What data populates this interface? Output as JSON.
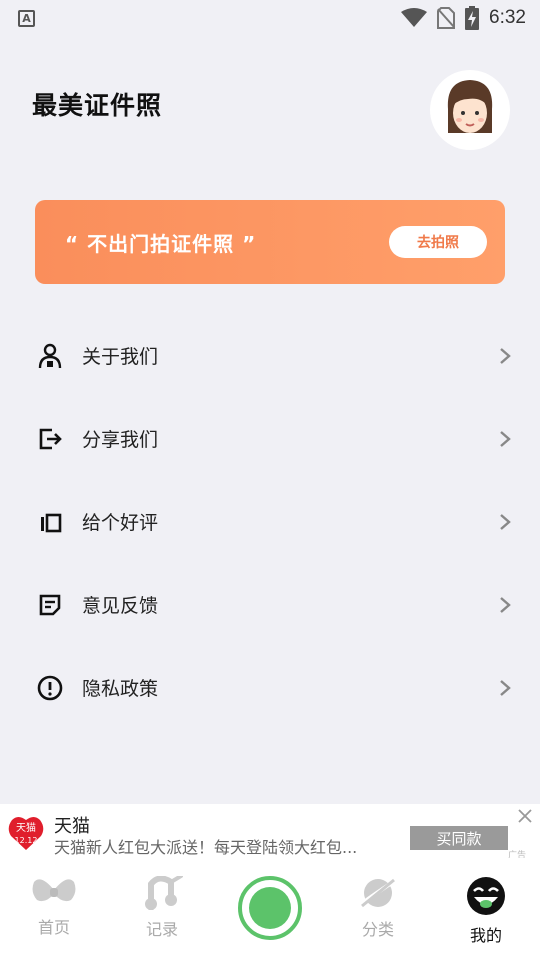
{
  "status_bar": {
    "time": "6:32",
    "a_label": "A"
  },
  "header": {
    "title": "最美证件照"
  },
  "banner": {
    "text": "“ 不出门拍证件照 ”",
    "button_label": "去拍照",
    "colors": {
      "start": "#fa8e5b",
      "end": "#ff9f6a"
    }
  },
  "menu": {
    "items": [
      {
        "label": "关于我们",
        "icon": "user-info-icon"
      },
      {
        "label": "分享我们",
        "icon": "share-icon"
      },
      {
        "label": "给个好评",
        "icon": "rate-icon"
      },
      {
        "label": "意见反馈",
        "icon": "feedback-icon"
      },
      {
        "label": "隐私政策",
        "icon": "privacy-icon"
      }
    ]
  },
  "ad": {
    "brand_logo_text": "天猫",
    "logo_date": "12.12",
    "title": "天猫",
    "description": "天猫新人红包大派送！每天登陆领大红包...",
    "button_label": "买同款",
    "tag": "广告"
  },
  "tabbar": {
    "tabs": [
      {
        "label": "首页",
        "icon": "bow-icon"
      },
      {
        "label": "记录",
        "icon": "record-icon"
      },
      {
        "label": "",
        "icon": "camera-shutter-icon"
      },
      {
        "label": "分类",
        "icon": "category-icon"
      },
      {
        "label": "我的",
        "icon": "profile-face-icon"
      }
    ],
    "active_index": 4,
    "accent": "#5cc36a"
  }
}
